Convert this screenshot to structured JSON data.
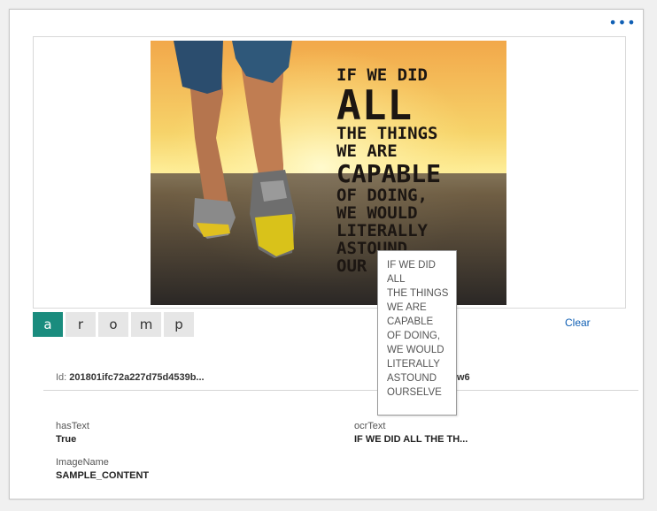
{
  "toolbar": {
    "more_label": "•••"
  },
  "image": {
    "quote_lines": [
      "IF WE DID",
      "ALL",
      "THE THINGS",
      "WE ARE",
      "CAPABLE",
      "OF DOING,",
      "WE WOULD",
      "LITERALLY",
      "ASTOUND",
      "OUR"
    ]
  },
  "tags": [
    {
      "label": "a",
      "active": true
    },
    {
      "label": "r",
      "active": false
    },
    {
      "label": "o",
      "active": false
    },
    {
      "label": "m",
      "active": false
    },
    {
      "label": "p",
      "active": false
    }
  ],
  "clear_label": "Clear",
  "meta": {
    "id_key": "Id:",
    "id_value": "201801ifc72a227d75d4539b...",
    "right_fragment": "w6"
  },
  "fields": {
    "hasText": {
      "label": "hasText",
      "value": "True"
    },
    "ocrText": {
      "label": "ocrText",
      "value": "IF WE DID ALL THE TH..."
    },
    "imageName": {
      "label": "ImageName",
      "value": "SAMPLE_CONTENT"
    }
  },
  "tooltip": {
    "lines": [
      "IF WE DID",
      "ALL",
      "THE THINGS",
      "WE ARE",
      "CAPABLE",
      "OF DOING,",
      "WE WOULD",
      "LITERALLY",
      "ASTOUND",
      "OURSELVE"
    ]
  },
  "colors": {
    "accent": "#1a8c7e",
    "link": "#0f5fb4"
  }
}
